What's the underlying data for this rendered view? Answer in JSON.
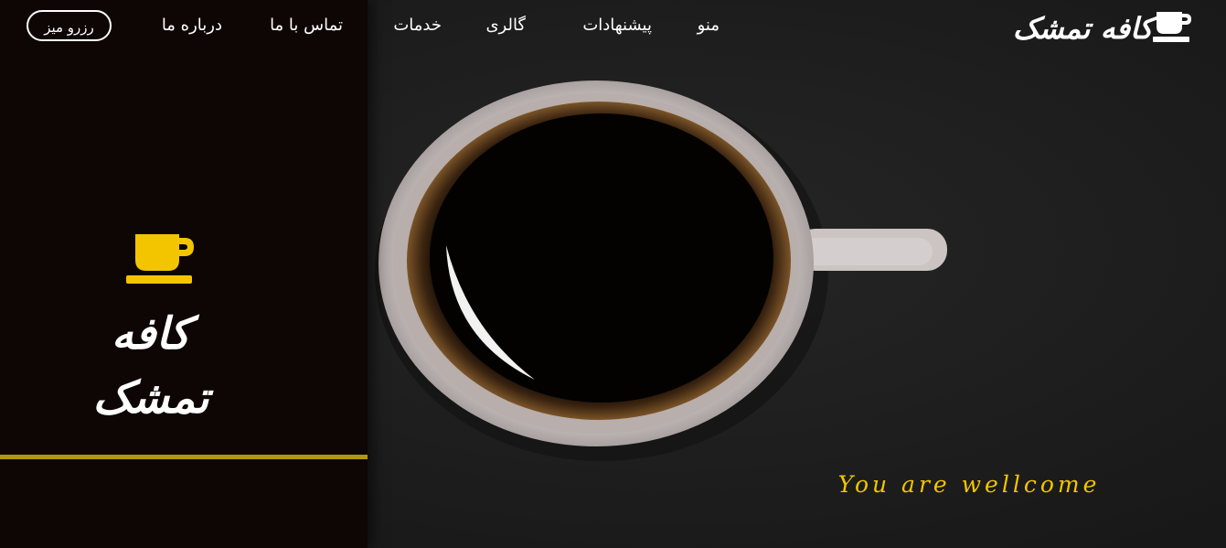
{
  "brand": {
    "name": "کافه تمشک",
    "icon": "coffee-cup-icon"
  },
  "nav": {
    "links": [
      "منو",
      "پیشنهادات",
      "گالری",
      "خدمات",
      "تماس با ما",
      "درباره ما"
    ],
    "reserve_label": "رزرو میز"
  },
  "side_panel": {
    "logo_text": "کافه تمشک",
    "logo_icon": "coffee-cup-icon"
  },
  "hero": {
    "tagline": "You are wellcome"
  },
  "colors": {
    "accent": "#f2c500",
    "divider": "#b5950f",
    "panel_bg": "#0e0604",
    "page_bg": "#1d1d1d",
    "text": "#ffffff"
  }
}
